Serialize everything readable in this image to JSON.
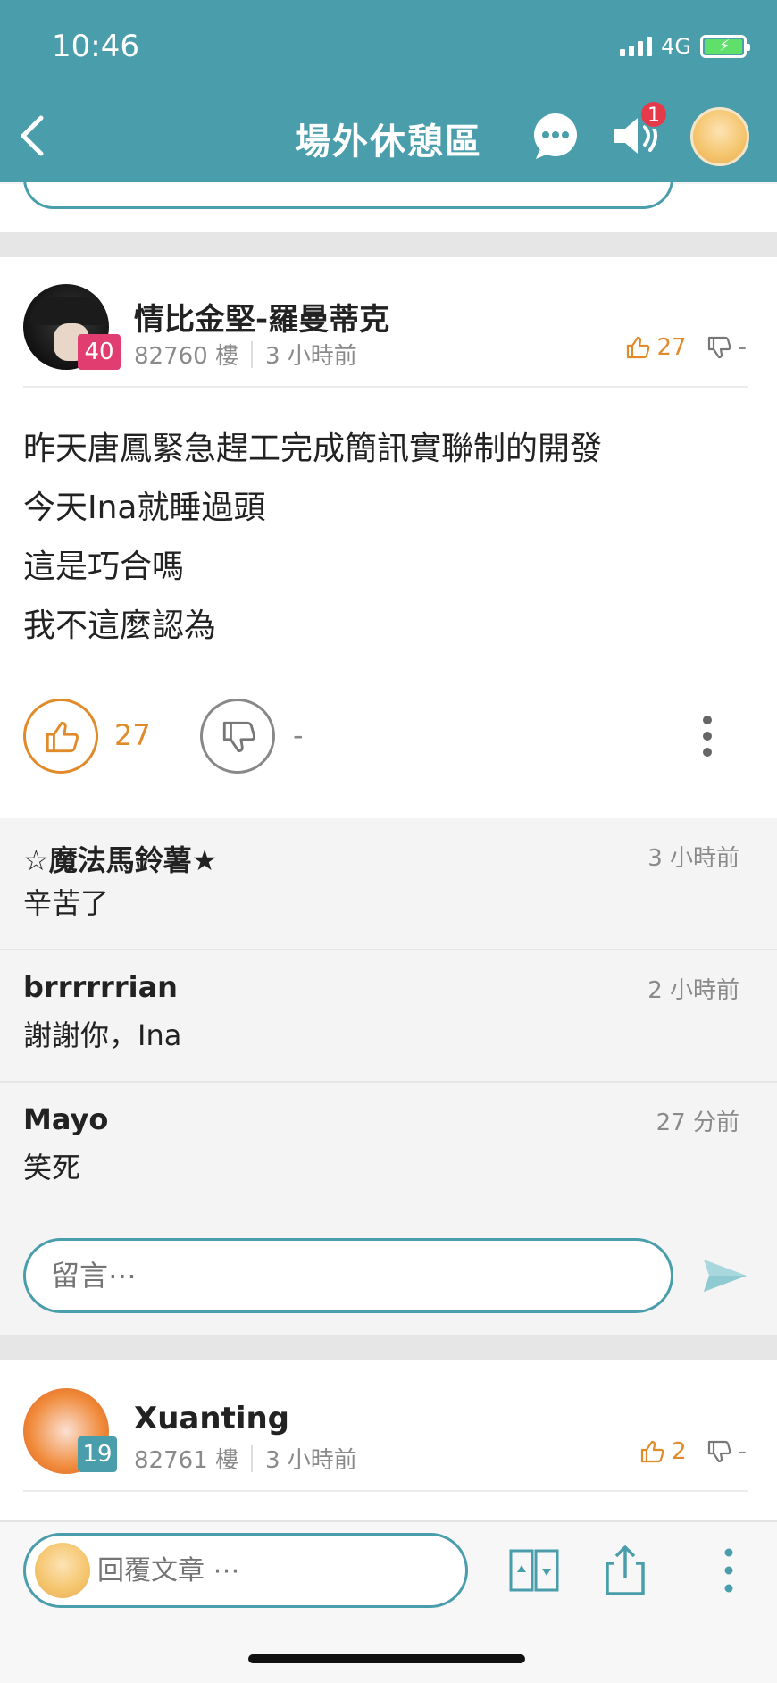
{
  "status": {
    "time": "10:46",
    "network": "4G"
  },
  "header": {
    "title": "場外休憩區",
    "notification_count": "1"
  },
  "post": {
    "author": "情比金堅-羅曼蒂克",
    "level": "40",
    "floor": "82760 樓",
    "time": "3 小時前",
    "upvotes": "27",
    "downvotes": "-",
    "content": [
      "昨天唐鳳緊急趕工完成簡訊實聯制的開發",
      "今天Ina就睡過頭",
      "這是巧合嗎",
      "我不這麼認為"
    ]
  },
  "comments": [
    {
      "name": "☆魔法馬鈴薯★",
      "time": "3 小時前",
      "text": "辛苦了"
    },
    {
      "name": "brrrrrrian",
      "time": "2 小時前",
      "text": "謝謝你，Ina"
    },
    {
      "name": "Mayo",
      "time": "27 分前",
      "text": "笑死"
    }
  ],
  "comment_input": {
    "placeholder": "留言⋯"
  },
  "next_post": {
    "author": "Xuanting",
    "level": "19",
    "floor": "82761 樓",
    "time": "3 小時前",
    "upvotes": "2",
    "downvotes": "-"
  },
  "bottom_bar": {
    "reply_placeholder": "回覆文章 ⋯"
  },
  "colors": {
    "header": "#4a9eac",
    "upvote": "#e08a2a",
    "level_badge_post": "#e23d70",
    "level_badge_next": "#4a9eac"
  }
}
